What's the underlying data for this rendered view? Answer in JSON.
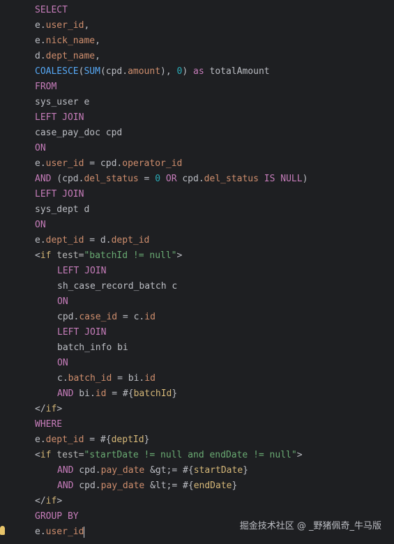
{
  "code": {
    "lines": [
      {
        "indent": 0,
        "tokens": [
          {
            "t": "SELECT",
            "c": "kwp"
          }
        ]
      },
      {
        "indent": 0,
        "tokens": [
          {
            "t": "e.",
            "c": "plain"
          },
          {
            "t": "user_id",
            "c": "kw"
          },
          {
            "t": ",",
            "c": "plain"
          }
        ]
      },
      {
        "indent": 0,
        "tokens": [
          {
            "t": "e.",
            "c": "plain"
          },
          {
            "t": "nick_name",
            "c": "kw"
          },
          {
            "t": ",",
            "c": "plain"
          }
        ]
      },
      {
        "indent": 0,
        "tokens": [
          {
            "t": "d.",
            "c": "plain"
          },
          {
            "t": "dept_name",
            "c": "kw"
          },
          {
            "t": ",",
            "c": "plain"
          }
        ]
      },
      {
        "indent": 0,
        "tokens": [
          {
            "t": "COALESCE",
            "c": "fn"
          },
          {
            "t": "(",
            "c": "plain"
          },
          {
            "t": "SUM",
            "c": "fn"
          },
          {
            "t": "(cpd.",
            "c": "plain"
          },
          {
            "t": "amount",
            "c": "kw"
          },
          {
            "t": "), ",
            "c": "plain"
          },
          {
            "t": "0",
            "c": "num"
          },
          {
            "t": ") ",
            "c": "plain"
          },
          {
            "t": "as",
            "c": "kwp"
          },
          {
            "t": " totalAmount",
            "c": "plain"
          }
        ]
      },
      {
        "indent": 0,
        "tokens": [
          {
            "t": "FROM",
            "c": "kwp"
          }
        ]
      },
      {
        "indent": 0,
        "tokens": [
          {
            "t": "sys_user e",
            "c": "plain"
          }
        ]
      },
      {
        "indent": 0,
        "tokens": [
          {
            "t": "LEFT JOIN",
            "c": "kwp"
          }
        ]
      },
      {
        "indent": 0,
        "tokens": [
          {
            "t": "case_pay_doc cpd",
            "c": "plain"
          }
        ]
      },
      {
        "indent": 0,
        "tokens": [
          {
            "t": "ON",
            "c": "kwp"
          }
        ]
      },
      {
        "indent": 0,
        "tokens": [
          {
            "t": "e.",
            "c": "plain"
          },
          {
            "t": "user_id",
            "c": "kw"
          },
          {
            "t": " = cpd.",
            "c": "plain"
          },
          {
            "t": "operator_id",
            "c": "kw"
          }
        ]
      },
      {
        "indent": 0,
        "tokens": [
          {
            "t": "AND",
            "c": "kwp"
          },
          {
            "t": " (cpd.",
            "c": "plain"
          },
          {
            "t": "del_status",
            "c": "kw"
          },
          {
            "t": " = ",
            "c": "plain"
          },
          {
            "t": "0",
            "c": "num"
          },
          {
            "t": " ",
            "c": "plain"
          },
          {
            "t": "OR",
            "c": "kwp"
          },
          {
            "t": " cpd.",
            "c": "plain"
          },
          {
            "t": "del_status",
            "c": "kw"
          },
          {
            "t": " ",
            "c": "plain"
          },
          {
            "t": "IS NULL",
            "c": "kwp"
          },
          {
            "t": ")",
            "c": "plain"
          }
        ]
      },
      {
        "indent": 0,
        "tokens": [
          {
            "t": "LEFT JOIN",
            "c": "kwp"
          }
        ]
      },
      {
        "indent": 0,
        "tokens": [
          {
            "t": "sys_dept d",
            "c": "plain"
          }
        ]
      },
      {
        "indent": 0,
        "tokens": [
          {
            "t": "ON",
            "c": "kwp"
          }
        ]
      },
      {
        "indent": 0,
        "tokens": [
          {
            "t": "e.",
            "c": "plain"
          },
          {
            "t": "dept_id",
            "c": "kw"
          },
          {
            "t": " = d.",
            "c": "plain"
          },
          {
            "t": "dept_id",
            "c": "kw"
          }
        ]
      },
      {
        "indent": 0,
        "tokens": [
          {
            "t": "<",
            "c": "plain"
          },
          {
            "t": "if",
            "c": "tag"
          },
          {
            "t": " test=",
            "c": "attr"
          },
          {
            "t": "\"batchId != null\"",
            "c": "str"
          },
          {
            "t": ">",
            "c": "plain"
          }
        ]
      },
      {
        "indent": 1,
        "tokens": [
          {
            "t": "LEFT JOIN",
            "c": "kwp"
          }
        ]
      },
      {
        "indent": 1,
        "tokens": [
          {
            "t": "sh_case_record_batch c",
            "c": "plain"
          }
        ]
      },
      {
        "indent": 1,
        "tokens": [
          {
            "t": "ON",
            "c": "kwp"
          }
        ]
      },
      {
        "indent": 1,
        "tokens": [
          {
            "t": "cpd.",
            "c": "plain"
          },
          {
            "t": "case_id",
            "c": "kw"
          },
          {
            "t": " = c.",
            "c": "plain"
          },
          {
            "t": "id",
            "c": "kw"
          }
        ]
      },
      {
        "indent": 1,
        "tokens": [
          {
            "t": "LEFT JOIN",
            "c": "kwp"
          }
        ]
      },
      {
        "indent": 1,
        "tokens": [
          {
            "t": "batch_info bi",
            "c": "plain"
          }
        ]
      },
      {
        "indent": 1,
        "tokens": [
          {
            "t": "ON",
            "c": "kwp"
          }
        ]
      },
      {
        "indent": 1,
        "tokens": [
          {
            "t": "c.",
            "c": "plain"
          },
          {
            "t": "batch_id",
            "c": "kw"
          },
          {
            "t": " = bi.",
            "c": "plain"
          },
          {
            "t": "id",
            "c": "kw"
          }
        ]
      },
      {
        "indent": 1,
        "tokens": [
          {
            "t": "AND",
            "c": "kwp"
          },
          {
            "t": " bi.",
            "c": "plain"
          },
          {
            "t": "id",
            "c": "kw"
          },
          {
            "t": " = #{",
            "c": "plain"
          },
          {
            "t": "batchId",
            "c": "param"
          },
          {
            "t": "}",
            "c": "plain"
          }
        ]
      },
      {
        "indent": 0,
        "tokens": [
          {
            "t": "</",
            "c": "plain"
          },
          {
            "t": "if",
            "c": "tag"
          },
          {
            "t": ">",
            "c": "plain"
          }
        ]
      },
      {
        "indent": 0,
        "tokens": [
          {
            "t": "WHERE",
            "c": "kwp"
          }
        ]
      },
      {
        "indent": 0,
        "tokens": [
          {
            "t": "e.",
            "c": "plain"
          },
          {
            "t": "dept_id",
            "c": "kw"
          },
          {
            "t": " = #{",
            "c": "plain"
          },
          {
            "t": "deptId",
            "c": "param"
          },
          {
            "t": "}",
            "c": "plain"
          }
        ]
      },
      {
        "indent": 0,
        "tokens": [
          {
            "t": "<",
            "c": "plain"
          },
          {
            "t": "if",
            "c": "tag"
          },
          {
            "t": " test=",
            "c": "attr"
          },
          {
            "t": "\"startDate != null and endDate != null\"",
            "c": "str"
          },
          {
            "t": ">",
            "c": "plain"
          }
        ]
      },
      {
        "indent": 1,
        "tokens": [
          {
            "t": "AND",
            "c": "kwp"
          },
          {
            "t": " cpd.",
            "c": "plain"
          },
          {
            "t": "pay_date",
            "c": "kw"
          },
          {
            "t": " &gt;= #{",
            "c": "plain"
          },
          {
            "t": "startDate",
            "c": "param"
          },
          {
            "t": "}",
            "c": "plain"
          }
        ]
      },
      {
        "indent": 1,
        "tokens": [
          {
            "t": "AND",
            "c": "kwp"
          },
          {
            "t": " cpd.",
            "c": "plain"
          },
          {
            "t": "pay_date",
            "c": "kw"
          },
          {
            "t": " &lt;= #{",
            "c": "plain"
          },
          {
            "t": "endDate",
            "c": "param"
          },
          {
            "t": "}",
            "c": "plain"
          }
        ]
      },
      {
        "indent": 0,
        "tokens": [
          {
            "t": "</",
            "c": "plain"
          },
          {
            "t": "if",
            "c": "tag"
          },
          {
            "t": ">",
            "c": "plain"
          }
        ]
      },
      {
        "indent": 0,
        "tokens": [
          {
            "t": "GROUP BY",
            "c": "kwp"
          }
        ]
      },
      {
        "indent": 0,
        "tokens": [
          {
            "t": "e.",
            "c": "plain"
          },
          {
            "t": "user_id",
            "c": "kw"
          }
        ],
        "caret": true
      }
    ]
  },
  "watermark": "掘金技术社区 @ _野猪佩奇_牛马版",
  "colors": {
    "background": "#1e1f22",
    "keyword": "#c77dbb",
    "field": "#cf8e6d",
    "function": "#56a8f5",
    "number": "#2aacb8",
    "string": "#6aab73",
    "tag": "#d5b778"
  }
}
